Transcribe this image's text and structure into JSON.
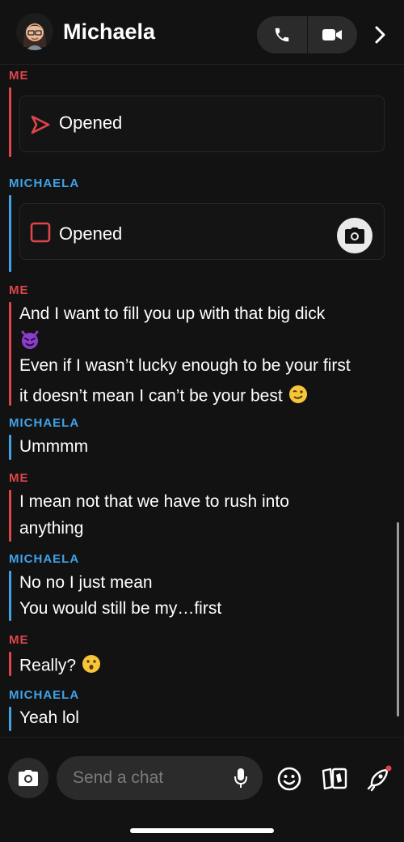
{
  "header": {
    "title": "Michaela"
  },
  "messages": {
    "me_label": "ME",
    "her_label": "MICHAELA",
    "snap1_label": "Opened",
    "snap2_label": "Opened",
    "g3_line1": "And I want to fill you up with that big dick",
    "g3_line2": "Even if I wasn’t lucky enough to be your first",
    "g3_line3": "it doesn’t mean I can’t be your best",
    "g4_line1": "Ummmm",
    "g5_line1": "I mean not that we have to rush into",
    "g5_line2": "anything",
    "g6_line1": "No no I just mean",
    "g6_line2": "You would still be my…first",
    "g7_line1": "Really?",
    "g8_line1": "Yeah lol"
  },
  "composer": {
    "placeholder": "Send a chat"
  },
  "colors": {
    "me": "#e0454a",
    "her": "#3fa3e8",
    "background": "#121212"
  },
  "icons": [
    "avatar",
    "phone-icon",
    "video-icon",
    "chevron-right-icon",
    "send-arrow-icon",
    "opened-square-icon",
    "camera-icon",
    "devil-emoji",
    "wink-emoji",
    "surprised-emoji",
    "mic-icon",
    "smiley-icon",
    "cards-icon",
    "rocket-icon"
  ]
}
